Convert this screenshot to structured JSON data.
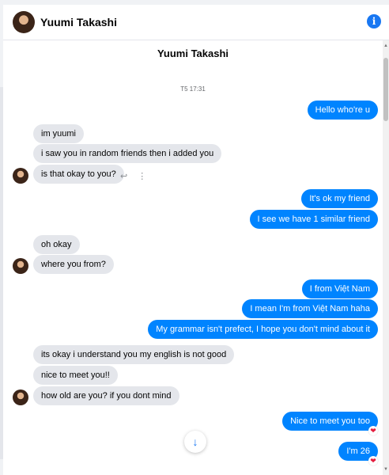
{
  "header": {
    "name": "Yuumi Takashi",
    "info_icon": "i"
  },
  "chat": {
    "title": "Yuumi Takashi",
    "timestamp": "T5 17:31",
    "messages": [
      {
        "side": "out",
        "text": "Hello who're u"
      },
      {
        "side": "in",
        "text": "im yuumi"
      },
      {
        "side": "in",
        "text": "i saw you in random friends then i added you"
      },
      {
        "side": "in",
        "text": "is that okay to you?"
      },
      {
        "side": "out",
        "text": "It's ok my friend"
      },
      {
        "side": "out",
        "text": "I see we have 1 similar friend"
      },
      {
        "side": "in",
        "text": "oh okay"
      },
      {
        "side": "in",
        "text": "where you from?"
      },
      {
        "side": "out",
        "text": "I from Việt Nam"
      },
      {
        "side": "out",
        "text": "I mean I'm from Việt Nam haha"
      },
      {
        "side": "out",
        "text": "My grammar isn't prefect, I hope you don't mind about it"
      },
      {
        "side": "in",
        "text": "its okay i understand you my english is not good"
      },
      {
        "side": "in",
        "text": "nice to meet you!!"
      },
      {
        "side": "in",
        "text": "how old are you? if you dont mind"
      },
      {
        "side": "out",
        "text": "Nice to meet you too"
      },
      {
        "side": "out",
        "text": "I'm 26"
      }
    ],
    "reaction": "❤",
    "reply_icon": "↩",
    "more_icon": "⋮",
    "scroll_down_icon": "↓"
  }
}
